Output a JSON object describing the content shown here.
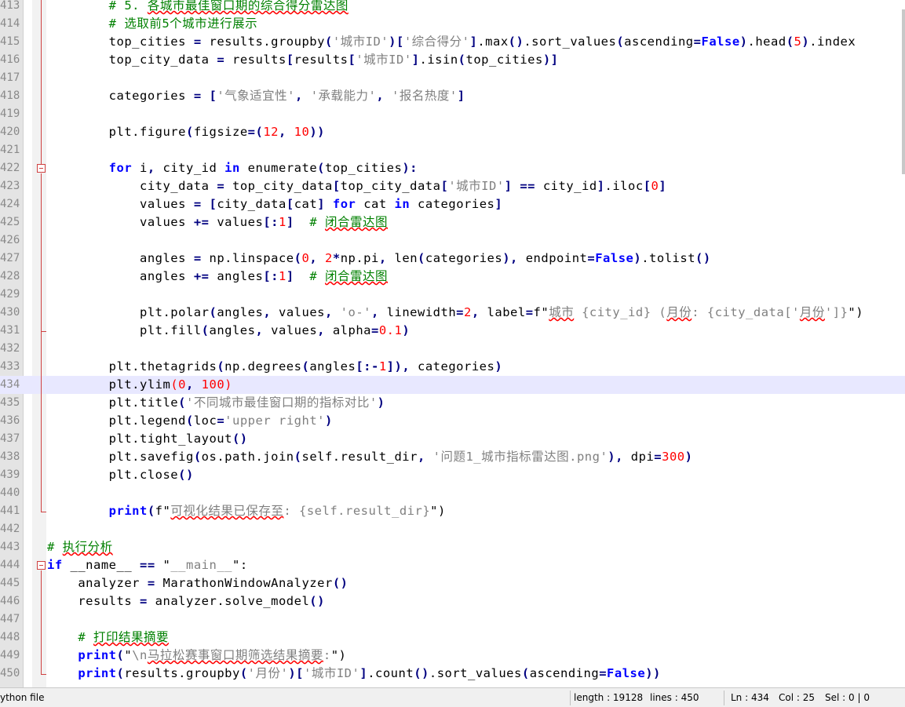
{
  "editor": {
    "current_line": "434",
    "lines": [
      {
        "n": "413",
        "indent": "        ",
        "segs": [
          {
            "t": "# 5. ",
            "c": "c"
          },
          {
            "t": "各城市最佳窗口期的综合得分雷达图",
            "c": "c sq"
          }
        ]
      },
      {
        "n": "414",
        "indent": "        ",
        "segs": [
          {
            "t": "# 选取前5个城市进行展示",
            "c": "c"
          }
        ]
      },
      {
        "n": "415",
        "indent": "        ",
        "segs": [
          {
            "t": "top_cities "
          },
          {
            "t": "=",
            "c": "o"
          },
          {
            "t": " results.groupby"
          },
          {
            "t": "(",
            "c": "o"
          },
          {
            "t": "'城市ID'",
            "c": "s"
          },
          {
            "t": ")[",
            "c": "o"
          },
          {
            "t": "'综合得分'",
            "c": "s"
          },
          {
            "t": "]",
            "c": "o"
          },
          {
            "t": ".max"
          },
          {
            "t": "()",
            "c": "o"
          },
          {
            "t": ".sort_values"
          },
          {
            "t": "(",
            "c": "o"
          },
          {
            "t": "ascending"
          },
          {
            "t": "=",
            "c": "o"
          },
          {
            "t": "False",
            "c": "k"
          },
          {
            "t": ")",
            "c": "o"
          },
          {
            "t": ".head"
          },
          {
            "t": "(",
            "c": "o"
          },
          {
            "t": "5",
            "c": "n"
          },
          {
            "t": ")",
            "c": "o"
          },
          {
            "t": ".index"
          }
        ]
      },
      {
        "n": "416",
        "indent": "        ",
        "segs": [
          {
            "t": "top_city_data "
          },
          {
            "t": "=",
            "c": "o"
          },
          {
            "t": " results"
          },
          {
            "t": "[",
            "c": "o"
          },
          {
            "t": "results"
          },
          {
            "t": "[",
            "c": "o"
          },
          {
            "t": "'城市ID'",
            "c": "s"
          },
          {
            "t": "]",
            "c": "o"
          },
          {
            "t": ".isin"
          },
          {
            "t": "(",
            "c": "o"
          },
          {
            "t": "top_cities"
          },
          {
            "t": ")]",
            "c": "o"
          }
        ]
      },
      {
        "n": "417",
        "indent": "",
        "segs": []
      },
      {
        "n": "418",
        "indent": "        ",
        "segs": [
          {
            "t": "categories "
          },
          {
            "t": "=",
            "c": "o"
          },
          {
            "t": " "
          },
          {
            "t": "[",
            "c": "o"
          },
          {
            "t": "'气象适宜性'",
            "c": "s"
          },
          {
            "t": ", ",
            "c": "o"
          },
          {
            "t": "'承载能力'",
            "c": "s"
          },
          {
            "t": ", ",
            "c": "o"
          },
          {
            "t": "'报名热度'",
            "c": "s"
          },
          {
            "t": "]",
            "c": "o"
          }
        ]
      },
      {
        "n": "419",
        "indent": "",
        "segs": []
      },
      {
        "n": "420",
        "indent": "        ",
        "segs": [
          {
            "t": "plt.figure"
          },
          {
            "t": "(",
            "c": "o"
          },
          {
            "t": "figsize"
          },
          {
            "t": "=(",
            "c": "o"
          },
          {
            "t": "12",
            "c": "n"
          },
          {
            "t": ", ",
            "c": "o"
          },
          {
            "t": "10",
            "c": "n"
          },
          {
            "t": "))",
            "c": "o"
          }
        ]
      },
      {
        "n": "421",
        "indent": "",
        "segs": []
      },
      {
        "n": "422",
        "indent": "        ",
        "segs": [
          {
            "t": "for",
            "c": "k"
          },
          {
            "t": " i"
          },
          {
            "t": ",",
            "c": "o"
          },
          {
            "t": " city_id "
          },
          {
            "t": "in",
            "c": "k"
          },
          {
            "t": " enumerate"
          },
          {
            "t": "(",
            "c": "o"
          },
          {
            "t": "top_cities"
          },
          {
            "t": "):",
            "c": "o"
          }
        ]
      },
      {
        "n": "423",
        "indent": "            ",
        "segs": [
          {
            "t": "city_data "
          },
          {
            "t": "=",
            "c": "o"
          },
          {
            "t": " top_city_data"
          },
          {
            "t": "[",
            "c": "o"
          },
          {
            "t": "top_city_data"
          },
          {
            "t": "[",
            "c": "o"
          },
          {
            "t": "'城市ID'",
            "c": "s"
          },
          {
            "t": "]",
            "c": "o"
          },
          {
            "t": " "
          },
          {
            "t": "==",
            "c": "o"
          },
          {
            "t": " city_id"
          },
          {
            "t": "]",
            "c": "o"
          },
          {
            "t": ".iloc"
          },
          {
            "t": "[",
            "c": "o"
          },
          {
            "t": "0",
            "c": "n"
          },
          {
            "t": "]",
            "c": "o"
          }
        ]
      },
      {
        "n": "424",
        "indent": "            ",
        "segs": [
          {
            "t": "values "
          },
          {
            "t": "=",
            "c": "o"
          },
          {
            "t": " "
          },
          {
            "t": "[",
            "c": "o"
          },
          {
            "t": "city_data"
          },
          {
            "t": "[",
            "c": "o"
          },
          {
            "t": "cat"
          },
          {
            "t": "]",
            "c": "o"
          },
          {
            "t": " "
          },
          {
            "t": "for",
            "c": "k"
          },
          {
            "t": " cat "
          },
          {
            "t": "in",
            "c": "k"
          },
          {
            "t": " categories"
          },
          {
            "t": "]",
            "c": "o"
          }
        ]
      },
      {
        "n": "425",
        "indent": "            ",
        "segs": [
          {
            "t": "values "
          },
          {
            "t": "+=",
            "c": "o"
          },
          {
            "t": " values"
          },
          {
            "t": "[:",
            "c": "o"
          },
          {
            "t": "1",
            "c": "n"
          },
          {
            "t": "]",
            "c": "o"
          },
          {
            "t": "  "
          },
          {
            "t": "# ",
            "c": "c"
          },
          {
            "t": "闭合雷达图",
            "c": "c sq"
          }
        ]
      },
      {
        "n": "426",
        "indent": "",
        "segs": []
      },
      {
        "n": "427",
        "indent": "            ",
        "segs": [
          {
            "t": "angles "
          },
          {
            "t": "=",
            "c": "o"
          },
          {
            "t": " np.linspace"
          },
          {
            "t": "(",
            "c": "o"
          },
          {
            "t": "0",
            "c": "n"
          },
          {
            "t": ", ",
            "c": "o"
          },
          {
            "t": "2",
            "c": "n"
          },
          {
            "t": "*",
            "c": "o"
          },
          {
            "t": "np.pi"
          },
          {
            "t": ", ",
            "c": "o"
          },
          {
            "t": "len"
          },
          {
            "t": "(",
            "c": "o"
          },
          {
            "t": "categories"
          },
          {
            "t": "), ",
            "c": "o"
          },
          {
            "t": "endpoint"
          },
          {
            "t": "=",
            "c": "o"
          },
          {
            "t": "False",
            "c": "k"
          },
          {
            "t": ")",
            "c": "o"
          },
          {
            "t": ".tolist"
          },
          {
            "t": "()",
            "c": "o"
          }
        ]
      },
      {
        "n": "428",
        "indent": "            ",
        "segs": [
          {
            "t": "angles "
          },
          {
            "t": "+=",
            "c": "o"
          },
          {
            "t": " angles"
          },
          {
            "t": "[:",
            "c": "o"
          },
          {
            "t": "1",
            "c": "n"
          },
          {
            "t": "]",
            "c": "o"
          },
          {
            "t": "  "
          },
          {
            "t": "# ",
            "c": "c"
          },
          {
            "t": "闭合雷达图",
            "c": "c sq"
          }
        ]
      },
      {
        "n": "429",
        "indent": "",
        "segs": []
      },
      {
        "n": "430",
        "indent": "            ",
        "segs": [
          {
            "t": "plt.polar"
          },
          {
            "t": "(",
            "c": "o"
          },
          {
            "t": "angles"
          },
          {
            "t": ", ",
            "c": "o"
          },
          {
            "t": "values"
          },
          {
            "t": ", ",
            "c": "o"
          },
          {
            "t": "'o-'",
            "c": "s"
          },
          {
            "t": ", ",
            "c": "o"
          },
          {
            "t": "linewidth"
          },
          {
            "t": "=",
            "c": "o"
          },
          {
            "t": "2",
            "c": "n"
          },
          {
            "t": ", ",
            "c": "o"
          },
          {
            "t": "label"
          },
          {
            "t": "=",
            "c": "o"
          },
          {
            "t": "f\""
          },
          {
            "t": "城市",
            "c": "s sq"
          },
          {
            "t": " {city_id} (",
            "c": "s"
          },
          {
            "t": "月份",
            "c": "s sq"
          },
          {
            "t": ": {city_data['",
            "c": "s"
          },
          {
            "t": "月份",
            "c": "s sq"
          },
          {
            "t": "']}",
            "c": "s"
          },
          {
            "t": "\")"
          }
        ]
      },
      {
        "n": "431",
        "indent": "            ",
        "segs": [
          {
            "t": "plt.fill"
          },
          {
            "t": "(",
            "c": "o"
          },
          {
            "t": "angles"
          },
          {
            "t": ", ",
            "c": "o"
          },
          {
            "t": "values"
          },
          {
            "t": ", ",
            "c": "o"
          },
          {
            "t": "alpha"
          },
          {
            "t": "=",
            "c": "o"
          },
          {
            "t": "0.1",
            "c": "n"
          },
          {
            "t": ")",
            "c": "o"
          }
        ]
      },
      {
        "n": "432",
        "indent": "",
        "segs": []
      },
      {
        "n": "433",
        "indent": "        ",
        "segs": [
          {
            "t": "plt.thetagrids"
          },
          {
            "t": "(",
            "c": "o"
          },
          {
            "t": "np.degrees"
          },
          {
            "t": "(",
            "c": "o"
          },
          {
            "t": "angles"
          },
          {
            "t": "[:-",
            "c": "o"
          },
          {
            "t": "1",
            "c": "n"
          },
          {
            "t": "]), ",
            "c": "o"
          },
          {
            "t": "categories"
          },
          {
            "t": ")",
            "c": "o"
          }
        ]
      },
      {
        "n": "434",
        "indent": "        ",
        "segs": [
          {
            "t": "plt.ylim"
          },
          {
            "t": "(",
            "c": "n"
          },
          {
            "t": "0",
            "c": "n"
          },
          {
            "t": ", ",
            "c": "o"
          },
          {
            "t": "100",
            "c": "n"
          },
          {
            "t": ")",
            "c": "n"
          }
        ]
      },
      {
        "n": "435",
        "indent": "        ",
        "segs": [
          {
            "t": "plt.title"
          },
          {
            "t": "(",
            "c": "o"
          },
          {
            "t": "'不同城市最佳窗口期的指标对比'",
            "c": "s"
          },
          {
            "t": ")",
            "c": "o"
          }
        ]
      },
      {
        "n": "436",
        "indent": "        ",
        "segs": [
          {
            "t": "plt.legend"
          },
          {
            "t": "(",
            "c": "o"
          },
          {
            "t": "loc"
          },
          {
            "t": "=",
            "c": "o"
          },
          {
            "t": "'upper right'",
            "c": "s"
          },
          {
            "t": ")",
            "c": "o"
          }
        ]
      },
      {
        "n": "437",
        "indent": "        ",
        "segs": [
          {
            "t": "plt.tight_layout"
          },
          {
            "t": "()",
            "c": "o"
          }
        ]
      },
      {
        "n": "438",
        "indent": "        ",
        "segs": [
          {
            "t": "plt.savefig"
          },
          {
            "t": "(",
            "c": "o"
          },
          {
            "t": "os.path.join"
          },
          {
            "t": "(",
            "c": "o"
          },
          {
            "t": "self.result_dir"
          },
          {
            "t": ", ",
            "c": "o"
          },
          {
            "t": "'问题1_城市指标雷达图.png'",
            "c": "s"
          },
          {
            "t": "), ",
            "c": "o"
          },
          {
            "t": "dpi"
          },
          {
            "t": "=",
            "c": "o"
          },
          {
            "t": "300",
            "c": "n"
          },
          {
            "t": ")",
            "c": "o"
          }
        ]
      },
      {
        "n": "439",
        "indent": "        ",
        "segs": [
          {
            "t": "plt.close"
          },
          {
            "t": "()",
            "c": "o"
          }
        ]
      },
      {
        "n": "440",
        "indent": "",
        "segs": []
      },
      {
        "n": "441",
        "indent": "        ",
        "segs": [
          {
            "t": "print",
            "c": "k"
          },
          {
            "t": "(",
            "c": "o"
          },
          {
            "t": "f\""
          },
          {
            "t": "可视化结果已保存至",
            "c": "s sq"
          },
          {
            "t": ": {self.result_dir}",
            "c": "s"
          },
          {
            "t": "\")"
          }
        ]
      },
      {
        "n": "442",
        "indent": "",
        "segs": []
      },
      {
        "n": "443",
        "indent": "",
        "segs": [
          {
            "t": "# ",
            "c": "c"
          },
          {
            "t": "执行分析",
            "c": "c sq"
          }
        ]
      },
      {
        "n": "444",
        "indent": "",
        "segs": [
          {
            "t": "if",
            "c": "k"
          },
          {
            "t": " __name__ "
          },
          {
            "t": "==",
            "c": "o"
          },
          {
            "t": " \""
          },
          {
            "t": "__main__",
            "c": "s"
          },
          {
            "t": "\":"
          }
        ]
      },
      {
        "n": "445",
        "indent": "    ",
        "segs": [
          {
            "t": "analyzer "
          },
          {
            "t": "=",
            "c": "o"
          },
          {
            "t": " MarathonWindowAnalyzer"
          },
          {
            "t": "()",
            "c": "o"
          }
        ]
      },
      {
        "n": "446",
        "indent": "    ",
        "segs": [
          {
            "t": "results "
          },
          {
            "t": "=",
            "c": "o"
          },
          {
            "t": " analyzer.solve_model"
          },
          {
            "t": "()",
            "c": "o"
          }
        ]
      },
      {
        "n": "447",
        "indent": "",
        "segs": []
      },
      {
        "n": "448",
        "indent": "    ",
        "segs": [
          {
            "t": "# ",
            "c": "c"
          },
          {
            "t": "打印结果摘要",
            "c": "c sq"
          }
        ]
      },
      {
        "n": "449",
        "indent": "    ",
        "segs": [
          {
            "t": "print",
            "c": "k"
          },
          {
            "t": "(",
            "c": "o"
          },
          {
            "t": "\""
          },
          {
            "t": "\\n",
            "c": "s"
          },
          {
            "t": "马拉松赛事窗口期筛选结果摘要",
            "c": "s sq"
          },
          {
            "t": ":",
            "c": "s"
          },
          {
            "t": "\")"
          }
        ]
      },
      {
        "n": "450",
        "indent": "    ",
        "segs": [
          {
            "t": "print",
            "c": "k"
          },
          {
            "t": "(",
            "c": "o"
          },
          {
            "t": "results.groupby"
          },
          {
            "t": "(",
            "c": "o"
          },
          {
            "t": "'月份'",
            "c": "s"
          },
          {
            "t": ")[",
            "c": "o"
          },
          {
            "t": "'城市ID'",
            "c": "s"
          },
          {
            "t": "]",
            "c": "o"
          },
          {
            "t": ".count"
          },
          {
            "t": "()",
            "c": "o"
          },
          {
            "t": ".sort_values"
          },
          {
            "t": "(",
            "c": "o"
          },
          {
            "t": "ascending"
          },
          {
            "t": "=",
            "c": "o"
          },
          {
            "t": "False",
            "c": "k"
          },
          {
            "t": "))",
            "c": "o"
          }
        ]
      }
    ]
  },
  "status": {
    "file_type": "ython file",
    "length": "length : 19128",
    "lines": "lines : 450",
    "ln": "Ln : 434",
    "col": "Col : 25",
    "sel": "Sel : 0 | 0"
  }
}
